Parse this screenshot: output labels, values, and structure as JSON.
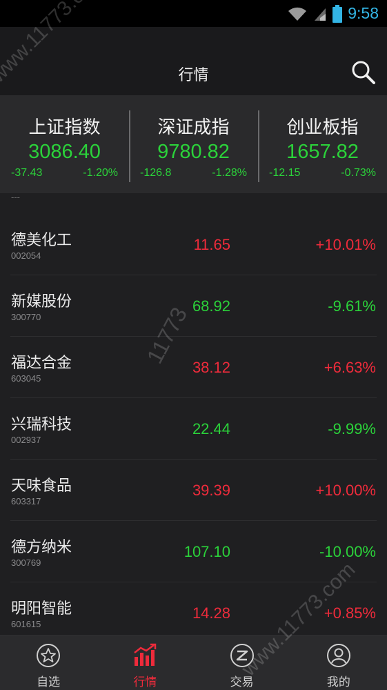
{
  "status_bar": {
    "time": "9:58",
    "icons": [
      "wifi-icon",
      "signal-icon",
      "battery-icon"
    ]
  },
  "header": {
    "title": "行情",
    "search_icon": "search-icon"
  },
  "indices": [
    {
      "name": "上证指数",
      "value": "3086.40",
      "change": "-37.43",
      "percent": "-1.20%"
    },
    {
      "name": "深证成指",
      "value": "9780.82",
      "change": "-126.8",
      "percent": "-1.28%"
    },
    {
      "name": "创业板指",
      "value": "1657.82",
      "change": "-12.15",
      "percent": "-0.73%"
    }
  ],
  "partial_row_code": "---",
  "stocks": [
    {
      "name": "德美化工",
      "code": "002054",
      "price": "11.65",
      "change": "+10.01%",
      "trend": "up"
    },
    {
      "name": "新媒股份",
      "code": "300770",
      "price": "68.92",
      "change": "-9.61%",
      "trend": "down"
    },
    {
      "name": "福达合金",
      "code": "603045",
      "price": "38.12",
      "change": "+6.63%",
      "trend": "up"
    },
    {
      "name": "兴瑞科技",
      "code": "002937",
      "price": "22.44",
      "change": "-9.99%",
      "trend": "down"
    },
    {
      "name": "天味食品",
      "code": "603317",
      "price": "39.39",
      "change": "+10.00%",
      "trend": "up"
    },
    {
      "name": "德方纳米",
      "code": "300769",
      "price": "107.10",
      "change": "-10.00%",
      "trend": "down"
    },
    {
      "name": "明阳智能",
      "code": "601615",
      "price": "14.28",
      "change": "+0.85%",
      "trend": "up"
    }
  ],
  "tabs": [
    {
      "label": "自选",
      "icon": "star-circle-icon",
      "active": false
    },
    {
      "label": "行情",
      "icon": "bar-chart-icon",
      "active": true
    },
    {
      "label": "交易",
      "icon": "trade-icon",
      "active": false
    },
    {
      "label": "我的",
      "icon": "user-icon",
      "active": false
    }
  ],
  "watermarks": {
    "site": "www.11773.com",
    "short": "11773"
  },
  "colors": {
    "up": "#ee2b3b",
    "down": "#2bd23a",
    "time": "#33b5e5",
    "background": "#1f1f21"
  }
}
